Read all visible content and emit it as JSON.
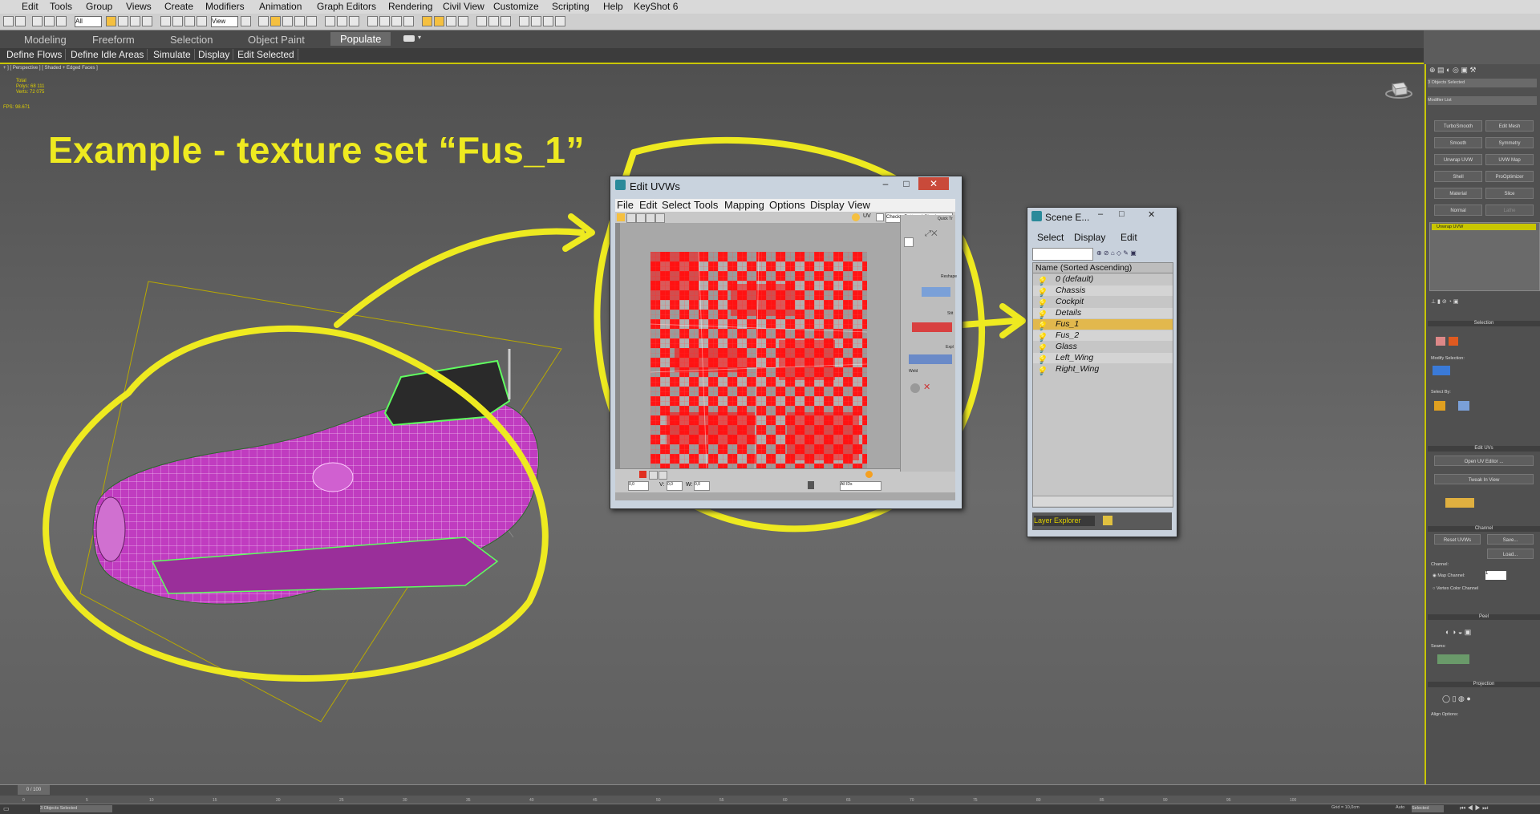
{
  "menubar": {
    "items": [
      "Edit",
      "Tools",
      "Group",
      "Views",
      "Create",
      "Modifiers",
      "Animation",
      "Graph Editors",
      "Rendering",
      "Civil View",
      "Customize",
      "Scripting",
      "Help",
      "KeyShot 6"
    ]
  },
  "toolbar": {
    "selection_filter": "All",
    "ref_coord": "View"
  },
  "ribbon": {
    "tabs": [
      "Modeling",
      "Freeform",
      "Selection",
      "Object Paint",
      "Populate"
    ],
    "active_tab": "Populate"
  },
  "subbar": {
    "buttons": [
      "Define Flows",
      "Define Idle Areas",
      "Simulate",
      "Display",
      "Edit Selected"
    ]
  },
  "viewport": {
    "label": "+ ] [ Perspective ] [ Shaded + Edged Faces ]",
    "stats": {
      "total_label": "Total",
      "polys_label": "Polys:",
      "polys": "68 111",
      "verts_label": "Verts:",
      "verts": "72 075",
      "fps_label": "FPS:",
      "fps": "98.671"
    },
    "headline": "Example - texture set “Fus_1”"
  },
  "uvw_window": {
    "title": "Edit UVWs",
    "menu": [
      "File",
      "Edit",
      "Select",
      "Tools",
      "Mapping",
      "Options",
      "Display",
      "View"
    ],
    "uv_label": "UV",
    "texture_dropdown": "CheckerPattern ( Checker",
    "panel_labels": [
      "Quick Tr",
      "Reshape",
      "Stit",
      "Expl",
      "Weld"
    ],
    "u_value": "0,0",
    "v_value": "0,0",
    "w_value": "0,0",
    "id_dropdown": "All IDs"
  },
  "scene_explorer": {
    "title": "Scene E...",
    "menu": [
      "Select",
      "Display",
      "Edit"
    ],
    "column_header": "Name (Sorted Ascending)",
    "items": [
      "0 (default)",
      "Chassis",
      "Cockpit",
      "Details",
      "Fus_1",
      "Fus_2",
      "Glass",
      "Left_Wing",
      "Right_Wing"
    ],
    "selected": "Fus_1",
    "footer_dropdown": "Layer Explorer"
  },
  "command_panel": {
    "objects_selected": "3 Objects Selected",
    "modifier_list": "Modifier List",
    "modifier_buttons": [
      "TurboSmooth",
      "Edit Mesh",
      "Smooth",
      "Symmetry",
      "Unwrap UVW",
      "UVW Map",
      "Shell",
      "ProOptimizer",
      "Material",
      "Slice",
      "Normal",
      "Lathe"
    ],
    "stack_item": "Unwrap UVW",
    "sections": [
      "Selection",
      "Edit UVs",
      "Channel",
      "Peel",
      "Projection"
    ],
    "modify_selection_label": "Modify Selection:",
    "select_by_label": "Select By:",
    "open_uv_editor": "Open UV Editor ...",
    "tweak_in_view": "Tweak In View",
    "reset_uvws": "Reset UVWs",
    "save": "Save...",
    "load": "Load...",
    "channel_label": "Channel:",
    "map_channel": "Map Channel:",
    "map_channel_value": "1",
    "vertex_color_channel": "Vertex Color Channel",
    "seams_label": "Seams:",
    "align_options": "Align Options:"
  },
  "timeline": {
    "frame": "0 / 100",
    "ticks": [
      "0",
      "5",
      "10",
      "15",
      "20",
      "25",
      "30",
      "35",
      "40",
      "45",
      "50",
      "55",
      "60",
      "65",
      "70",
      "75",
      "80",
      "85",
      "90",
      "95",
      "100"
    ]
  },
  "status": {
    "selection": "3 Objects Selected",
    "grid": "Grid = 10,0cm",
    "auto": "Auto",
    "set_key": "Selected"
  },
  "colors": {
    "annotation": "#eeea20",
    "uv_red": "#ff1010",
    "mesh": "#c040c0",
    "selected_row": "#e2b84d"
  }
}
